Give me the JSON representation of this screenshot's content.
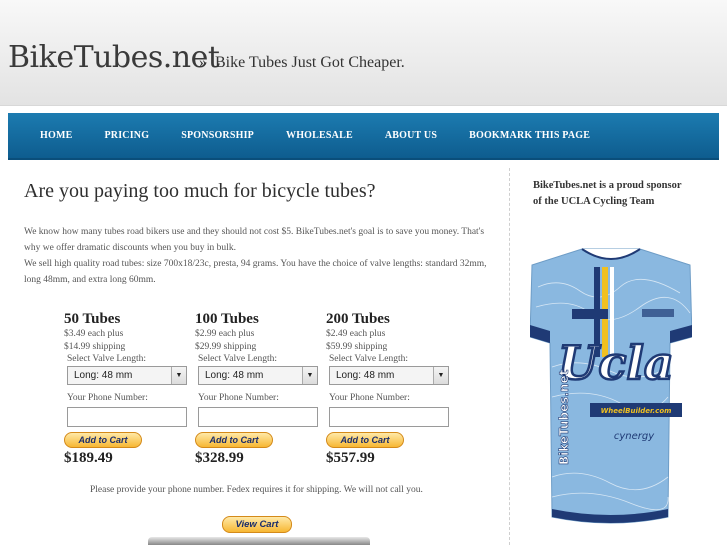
{
  "site": {
    "logo": "BikeTubes.net",
    "tagline": "Bike Tubes Just Got Cheaper.",
    "tagline_prefix": "»"
  },
  "nav": {
    "items": [
      {
        "label": "HOME"
      },
      {
        "label": "PRICING"
      },
      {
        "label": "SPONSORSHIP"
      },
      {
        "label": "WHOLESALE"
      },
      {
        "label": "ABOUT US"
      },
      {
        "label": "BOOKMARK THIS PAGE"
      }
    ]
  },
  "main": {
    "title": "Are you paying too much for bicycle tubes?",
    "intro_1": "We know how many tubes road bikers use and they should not cost $5. BikeTubes.net's goal is to save you money. That's why we offer dramatic discounts when you buy in bulk.",
    "intro_2": "We sell high quality road tubes: size 700x18/23c, presta, 94 grams. You have the choice of valve lengths: standard 32mm, long 48mm, and extra long 60mm.",
    "products": [
      {
        "title": "50 Tubes",
        "each": "$3.49 each plus",
        "shipping": "$14.99 shipping",
        "valve_label": "Select Valve Length:",
        "valve_value": "Long: 48 mm",
        "phone_label": "Your Phone Number:",
        "cart_label": "Add to Cart",
        "price": "$189.49"
      },
      {
        "title": "100 Tubes",
        "each": "$2.99 each plus",
        "shipping": "$29.99 shipping",
        "valve_label": "Select Valve Length:",
        "valve_value": "Long: 48 mm",
        "phone_label": "Your Phone Number:",
        "cart_label": "Add to Cart",
        "price": "$328.99"
      },
      {
        "title": "200 Tubes",
        "each": "$2.49 each plus",
        "shipping": "$59.99 shipping",
        "valve_label": "Select Valve Length:",
        "valve_value": "Long: 48 mm",
        "phone_label": "Your Phone Number:",
        "cart_label": "Add to Cart",
        "price": "$557.99"
      }
    ],
    "note": "Please provide your phone number. Fedex requires it for shipping. We will not call you.",
    "view_cart_label": "View Cart"
  },
  "sidebar": {
    "text": "BikeTubes.net is a proud sponsor of the UCLA Cycling Team",
    "jersey": {
      "main_text": "Ucla",
      "side_text": "BikeTubes.net",
      "sponsor_1": "WheelBuilder.com",
      "sponsor_2": "cynergy",
      "colors": {
        "blue": "#8ab8e0",
        "navy": "#1f3a75",
        "gold": "#f0c020",
        "white": "#ffffff"
      }
    }
  }
}
